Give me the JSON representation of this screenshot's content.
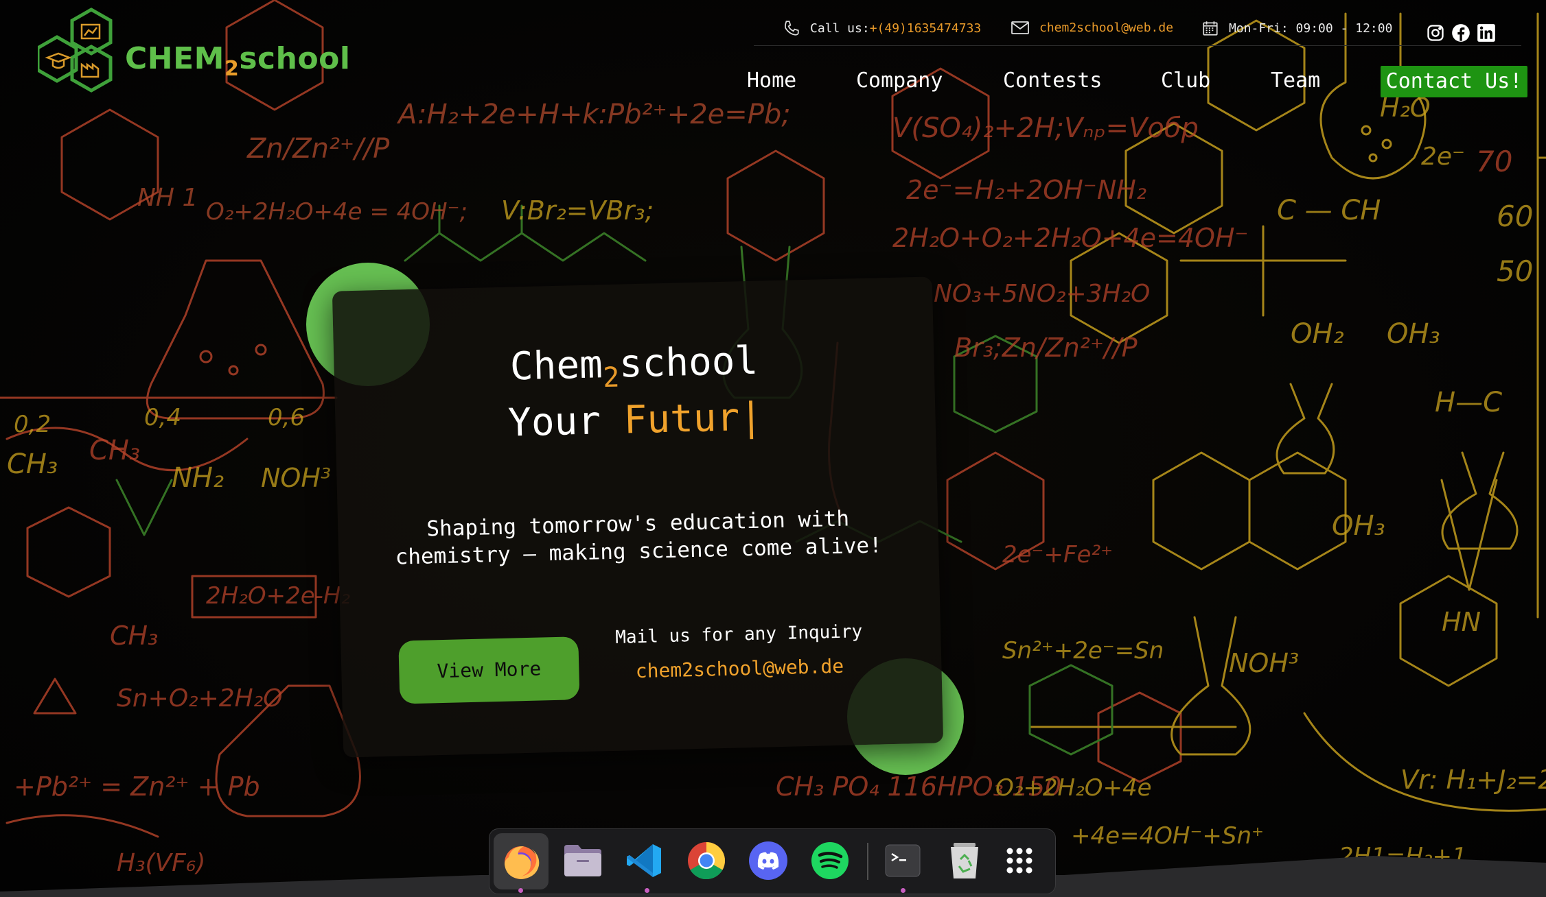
{
  "brand": {
    "name_part1": "CHEM",
    "name_sub": "2",
    "name_part2": "school"
  },
  "topbar": {
    "phone_label": "Call us:",
    "phone_value": "+(49)1635474733",
    "email_value": "chem2school@web.de",
    "hours_value": "Mon-Fri: 09:00 - 12:00",
    "icons": [
      "phone-icon",
      "mail-icon",
      "calendar-icon",
      "instagram-icon",
      "facebook-icon",
      "linkedin-icon"
    ]
  },
  "nav": {
    "items": [
      "Home",
      "Company",
      "Contests",
      "Club",
      "Team"
    ],
    "cta": "Contact Us!"
  },
  "hero": {
    "title_part1": "Chem",
    "title_sub": "2",
    "title_part2": "school",
    "subtitle_prefix": "Your",
    "subtitle_typed": "Futur",
    "caret": "|",
    "tagline": "Shaping tomorrow's education with chemistry – making science come alive!",
    "button": "View More",
    "mail_label": "Mail us for any Inquiry",
    "mail_address": "chem2school@web.de"
  },
  "dock": {
    "apps": [
      "firefox-icon",
      "files-icon",
      "vscode-icon",
      "chrome-icon",
      "discord-icon",
      "spotify-icon",
      "terminal-icon",
      "trash-icon",
      "app-grid-icon"
    ]
  },
  "colors": {
    "accent_green": "#5fbf4a",
    "accent_orange": "#f0a22c",
    "cta_green": "#1e9412",
    "button_green": "#4e9f2c"
  }
}
